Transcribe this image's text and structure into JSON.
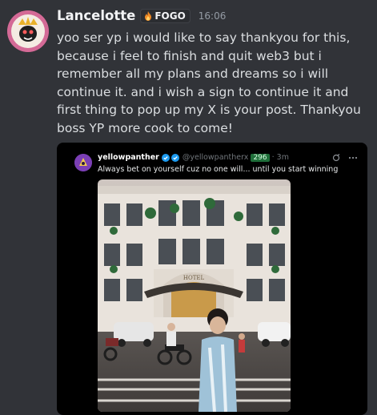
{
  "message": {
    "username": "Lancelotte",
    "tag": "FOGO",
    "timestamp": "16:06",
    "text": "yoo ser yp i would like to say thankyou for this, because i feel to finish and quit web3 but i remember all my plans and dreams so i will continue it. and i wish a sign to continue it and first thing to pop up my X is your post. Thankyou boss YP more cook to come!"
  },
  "embed": {
    "author_name": "yellowpanther",
    "handle": "@yellowpantherx",
    "count": "296",
    "time_ago": "· 3m",
    "text": "Always bet on yourself cuz no one will... until you start winning",
    "photo_sign": "HOTEL"
  },
  "colors": {
    "background": "#313338",
    "username": "#f2f3f5",
    "message_text": "#dbdee1",
    "timestamp": "#949ba4",
    "embed_bg": "#000000",
    "tag_fire": "#f08a24"
  },
  "icons": [
    "fire-icon",
    "verified-badge-icon",
    "grok-icon",
    "more-icon"
  ]
}
